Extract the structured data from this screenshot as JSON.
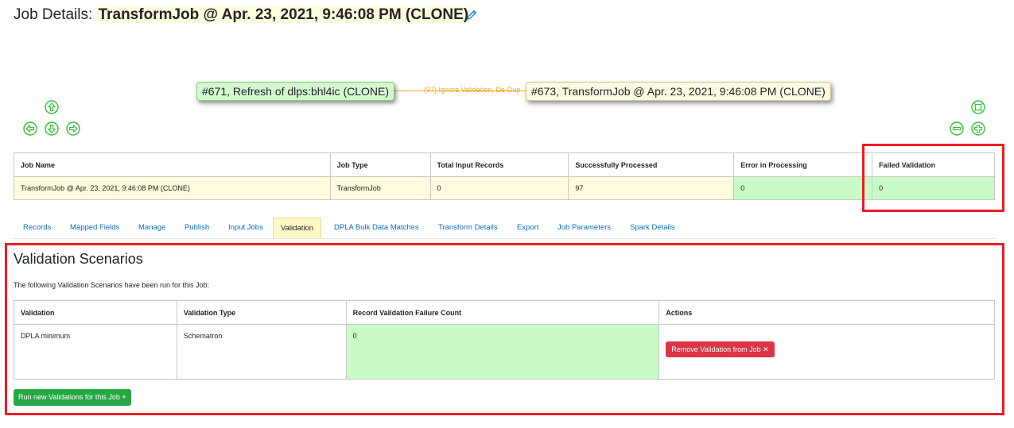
{
  "header": {
    "prefix": "Job Details:",
    "job_title": "TransformJob @ Apr. 23, 2021, 9:46:08 PM (CLONE)"
  },
  "graph": {
    "node_source": "#671, Refresh of dlps:bhl4ic (CLONE)",
    "node_target": "#673, TransformJob @ Apr. 23, 2021, 9:46:08 PM (CLONE)",
    "edge_label": "(97) Ignore Validation, De-Dup"
  },
  "stats": {
    "headers": [
      "Job Name",
      "Job Type",
      "Total Input Records",
      "Successfully Processed",
      "Error in Processing",
      "Failed Validation"
    ],
    "row": [
      "TransformJob @ Apr. 23, 2021, 9:46:08 PM (CLONE)",
      "TransformJob",
      "0",
      "97",
      "0",
      "0"
    ]
  },
  "tabs": [
    {
      "label": "Records"
    },
    {
      "label": "Mapped Fields"
    },
    {
      "label": "Manage"
    },
    {
      "label": "Publish"
    },
    {
      "label": "Input Jobs"
    },
    {
      "label": "Validation"
    },
    {
      "label": "DPLA Bulk Data Matches"
    },
    {
      "label": "Transform Details"
    },
    {
      "label": "Export"
    },
    {
      "label": "Job Parameters"
    },
    {
      "label": "Spark Details"
    }
  ],
  "active_tab": "Validation",
  "validation": {
    "title": "Validation Scenarios",
    "description": "The following Validation Scenarios have been run for this Job:",
    "headers": [
      "Validation",
      "Validation Type",
      "Record Validation Failure Count",
      "Actions"
    ],
    "row": {
      "name": "DPLA minimum",
      "type": "Schematron",
      "failure_count": "0",
      "action_label": "Remove Validation from Job ✕"
    },
    "run_button_label": "Run new Validations for this Job +"
  },
  "colors": {
    "link": "#0b6bc4",
    "green_cell": "#c9fbc6",
    "yellow_cell": "#fffbdc",
    "danger": "#dc3545",
    "success": "#28a745",
    "highlight": "#ed1c24",
    "edge": "#f5a623"
  },
  "icons": [
    "pencil-icon",
    "arrow-up-icon",
    "arrow-left-icon",
    "arrow-down-icon",
    "arrow-right-icon",
    "zoom-fit-icon",
    "zoom-out-icon",
    "zoom-in-icon"
  ]
}
